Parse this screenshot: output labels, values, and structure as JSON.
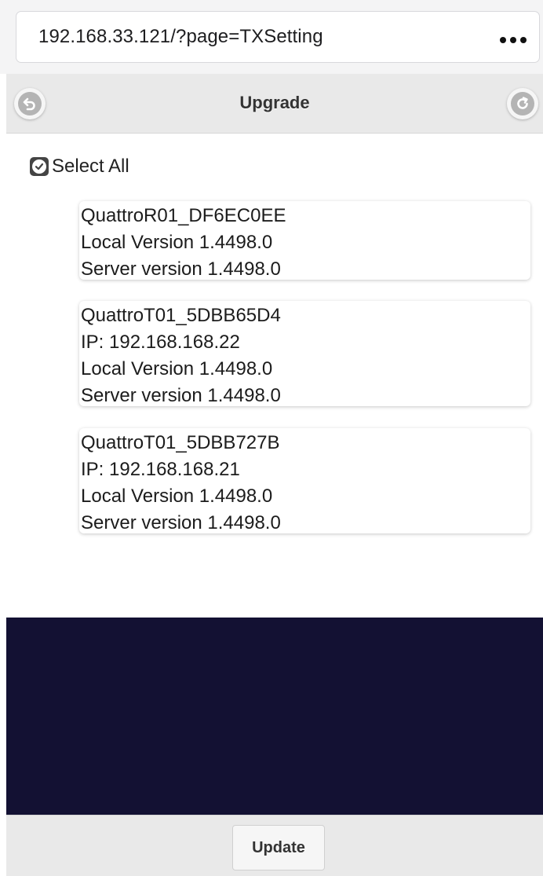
{
  "browser": {
    "url": "192.168.33.121/?page=TXSetting",
    "more_icon": "more-horizontal-icon"
  },
  "header": {
    "title": "Upgrade",
    "back_icon": "back-arrow-icon",
    "refresh_icon": "refresh-icon"
  },
  "select_all": {
    "label": "Select All",
    "checked": true
  },
  "devices": [
    {
      "name": "QuattroR01_DF6EC0EE",
      "local_version": "Local Version 1.4498.0",
      "server_version": "Server version 1.4498.0"
    },
    {
      "name": "QuattroT01_5DBB65D4",
      "ip": "IP: 192.168.168.22",
      "local_version": "Local Version 1.4498.0",
      "server_version": "Server version 1.4498.0"
    },
    {
      "name": "QuattroT01_5DBB727B",
      "ip": "IP: 192.168.168.21",
      "local_version": "Local Version 1.4498.0",
      "server_version": "Server version 1.4498.0"
    }
  ],
  "footer": {
    "update_label": "Update"
  },
  "colors": {
    "dark_panel": "#131133",
    "header_bg": "#e9e9e9"
  }
}
